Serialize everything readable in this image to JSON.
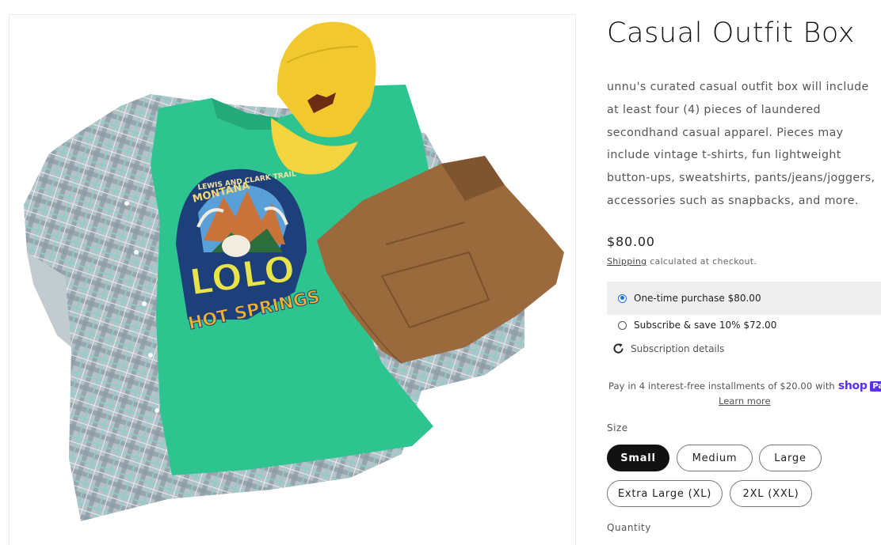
{
  "product": {
    "title": "Casual Outfit Box",
    "description": "unnu's curated casual outfit box will include at least four (4) pieces of laundered secondhand casual apparel.  Pieces may include vintage t-shirts, fun lightweight button-ups, sweatshirts, pants/jeans/joggers, accessories such as snapbacks, and more.",
    "price": "$80.00",
    "image_alt": "Flat lay of a plaid button-up shirt, green Montana graphic t-shirt, yellow cap and folded brown pants",
    "tshirt_graphic": {
      "arc_text": "LEWIS AND CLARK TRAIL",
      "state_text": "MONTANA",
      "big_text": "LOLO",
      "bottom_text": "HOT SPRINGS"
    }
  },
  "shipping": {
    "link_text": "Shipping",
    "note_text": "calculated at checkout."
  },
  "purchase_options": [
    {
      "label": "One-time purchase $80.00",
      "selected": true
    },
    {
      "label": "Subscribe & save 10% $72.00",
      "selected": false
    }
  ],
  "subscription_details_label": "Subscription details",
  "shop_pay": {
    "text": "Pay in 4 interest-free installments of $20.00 with",
    "brand_shop": "shop",
    "brand_pay": "Pay",
    "learn_more": "Learn more"
  },
  "size": {
    "label": "Size",
    "options": [
      "Small",
      "Medium",
      "Large",
      "Extra Large (XL)",
      "2XL (XXL)"
    ],
    "selected": "Small"
  },
  "quantity_label": "Quantity",
  "colors": {
    "accent_purple": "#5a31f4",
    "radio_blue": "#1a73e8",
    "selected_pill": "#121212",
    "option_bg": "#efefef"
  }
}
